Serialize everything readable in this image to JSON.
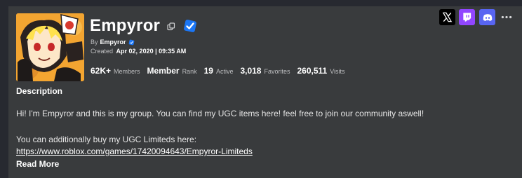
{
  "group": {
    "name": "Empyror",
    "by_prefix": "By",
    "owner": "Empyror",
    "created_prefix": "Created",
    "created_date": "Apr 02, 2020 | 09:35 AM"
  },
  "stats": [
    {
      "value": "62K+",
      "label": "Members"
    },
    {
      "value": "Member",
      "label": "Rank"
    },
    {
      "value": "19",
      "label": "Active"
    },
    {
      "value": "3,018",
      "label": "Favorites"
    },
    {
      "value": "260,511",
      "label": "Visits"
    }
  ],
  "description": {
    "heading": "Description",
    "paragraph1": "Hi! I'm Empyror and this is my group. You can find my UGC items here! feel free to join our community aswell!",
    "paragraph2": "You can additionally buy my UGC Limiteds here:",
    "link": "https://www.roblox.com/games/17420094643/Empyror-Limiteds",
    "read_more": "Read More"
  },
  "icons": {
    "copy": "copy-icon",
    "verified": "verified-badge-icon",
    "x": "x-logo-icon",
    "twitch": "twitch-logo-icon",
    "discord": "discord-logo-icon",
    "more": "more-options-icon"
  },
  "colors": {
    "background": "#272930",
    "card": "#393b3d",
    "verified_blue": "#1b76f5",
    "twitch": "#9146ff",
    "discord": "#5865f2",
    "x": "#000000",
    "avatar_orange": "#f3a531"
  }
}
